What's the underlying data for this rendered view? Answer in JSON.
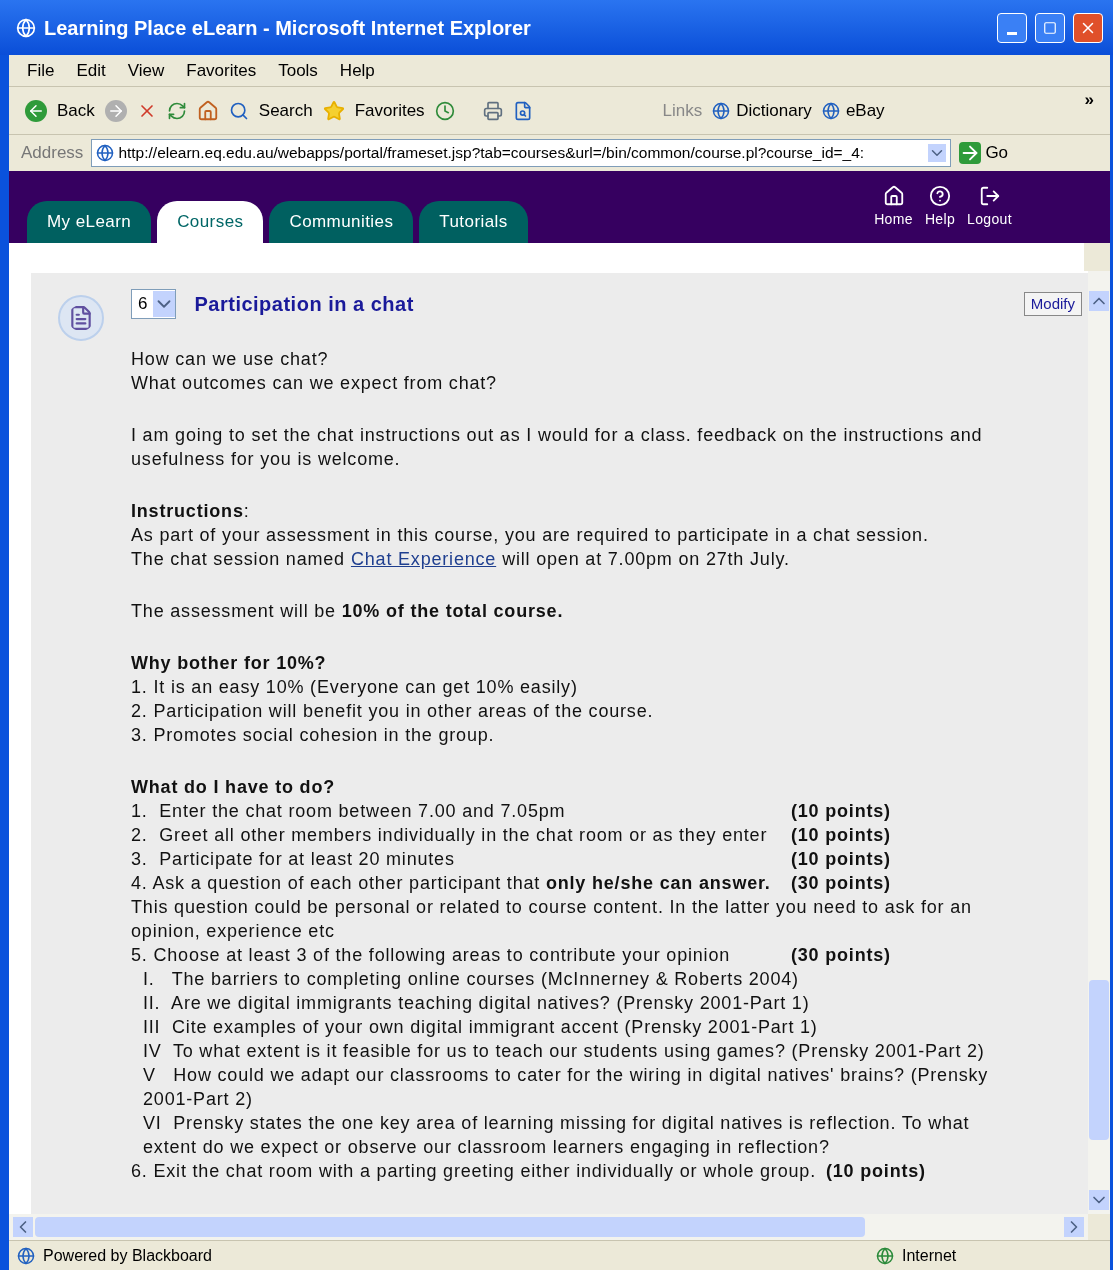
{
  "window": {
    "title": "Learning Place eLearn - Microsoft Internet Explorer"
  },
  "menu": [
    "File",
    "Edit",
    "View",
    "Favorites",
    "Tools",
    "Help"
  ],
  "toolbar": {
    "back": "Back",
    "search": "Search",
    "favorites": "Favorites",
    "links_label": "Links",
    "links": [
      "Dictionary",
      "eBay"
    ],
    "overflow": "»"
  },
  "address": {
    "label": "Address",
    "value": "http://elearn.eq.edu.au/webapps/portal/frameset.jsp?tab=courses&url=/bin/common/course.pl?course_id=_4:",
    "go": "Go"
  },
  "portal_tabs": [
    {
      "label": "My eLearn",
      "selected": false
    },
    {
      "label": "Courses",
      "selected": true
    },
    {
      "label": "Communities",
      "selected": false
    },
    {
      "label": "Tutorials",
      "selected": false
    }
  ],
  "header_links": [
    {
      "kind": "home",
      "label": "Home"
    },
    {
      "kind": "help",
      "label": "Help"
    },
    {
      "kind": "logout",
      "label": "Logout"
    }
  ],
  "item": {
    "number": "6",
    "title": "Participation in a chat",
    "modify": "Modify",
    "lines": [
      {
        "kind": "text",
        "text": "How can we use chat?"
      },
      {
        "kind": "text",
        "text": "What outcomes can we expect from chat?"
      },
      {
        "kind": "gap"
      },
      {
        "kind": "text",
        "text": "I am going to set the chat instructions out as I would for a class. feedback on the instructions and usefulness for you is welcome."
      },
      {
        "kind": "gap"
      },
      {
        "kind": "text",
        "text": "**Instructions**:"
      },
      {
        "kind": "text",
        "text": "As part of your assessment in this course, you are required to participate in a chat session."
      },
      {
        "kind": "link",
        "before": "The chat session named",
        "link": "Chat Experience",
        "after": "will open at 7.00pm on 27th July."
      },
      {
        "kind": "gap"
      },
      {
        "kind": "text",
        "text": "The assessment will be **10% of the total course.**"
      },
      {
        "kind": "gap"
      },
      {
        "kind": "heading",
        "text": "Why bother for 10%?"
      },
      {
        "kind": "text",
        "text": "1. It is an easy 10% (Everyone can get 10% easily)"
      },
      {
        "kind": "text",
        "text": "2. Participation will benefit you in other areas of the course."
      },
      {
        "kind": "text",
        "text": "3. Promotes social cohesion in the group."
      },
      {
        "kind": "gap"
      },
      {
        "kind": "heading",
        "text": "What do I have to do?"
      },
      {
        "kind": "scored",
        "text": "1.  Enter the chat room between 7.00 and 7.05pm",
        "points": "(10 points)"
      },
      {
        "kind": "scored",
        "text": "2.  Greet all other members individually in the chat room or as they enter",
        "points": "(10 points)"
      },
      {
        "kind": "scored",
        "text": "3.  Participate for at least 20 minutes",
        "points": "(10 points)"
      },
      {
        "kind": "scored",
        "text": "4. Ask a question of each other participant that **only he/she can answer.**",
        "points": "(30 points)"
      },
      {
        "kind": "text",
        "text": "This question could be personal or related to course content. In the latter you need to ask for an opinion, experience etc"
      },
      {
        "kind": "scored",
        "text": "5. Choose at least 3 of the following areas to contribute your opinion",
        "points": "(30 points)"
      },
      {
        "kind": "sub",
        "text": "I.   The barriers to completing online courses (McInnerney & Roberts 2004)"
      },
      {
        "kind": "sub",
        "text": "II.  Are we digital immigrants teaching digital natives? (Prensky 2001-Part 1)"
      },
      {
        "kind": "sub",
        "text": "III  Cite examples of your own digital immigrant accent (Prensky 2001-Part 1)"
      },
      {
        "kind": "sub",
        "text": "IV  To what extent is it feasible for us to teach our students using games? (Prensky 2001-Part 2)"
      },
      {
        "kind": "sub",
        "text": "V   How could we adapt our classrooms to cater for the wiring in digital natives' brains? (Prensky 2001-Part 2)"
      },
      {
        "kind": "sub",
        "text": "VI  Prensky states the one key area of learning missing for digital natives is reflection. To what extent do we expect or observe our classroom learners engaging in reflection?"
      },
      {
        "kind": "scored",
        "text": "6. Exit the chat room with a parting greeting either individually or whole group.",
        "points": "(10 points)"
      }
    ]
  },
  "status_bar": {
    "text": "Powered by Blackboard",
    "zone": "Internet"
  }
}
